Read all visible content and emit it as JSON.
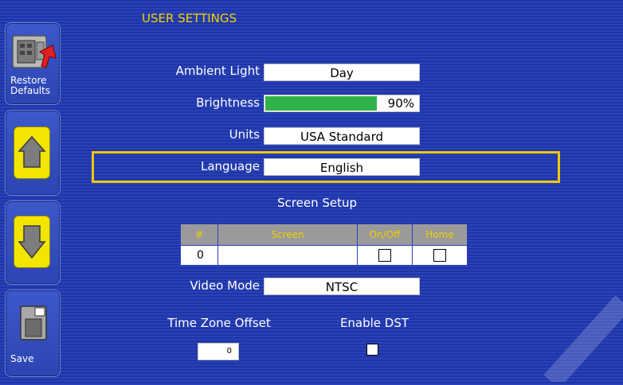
{
  "header": {
    "title": "USER SETTINGS"
  },
  "sidebar": {
    "restore_label_1": "Restore",
    "restore_label_2": "Defaults",
    "up_icon": "arrow-up-icon",
    "down_icon": "arrow-down-icon",
    "save_label": "Save"
  },
  "settings": {
    "ambient_light": {
      "label": "Ambient Light",
      "value": "Day"
    },
    "brightness": {
      "label": "Brightness",
      "value": "90%",
      "level": 0.9
    },
    "units": {
      "label": "Units",
      "value": "USA Standard"
    },
    "language": {
      "label": "Language",
      "value": "English"
    }
  },
  "screen_setup": {
    "title": "Screen Setup",
    "columns": [
      "#",
      "Screen",
      "On/Off",
      "Home"
    ],
    "rows": [
      {
        "num": "0",
        "screen": "",
        "on_off": false,
        "home": false
      }
    ]
  },
  "video_mode": {
    "label": "Video Mode",
    "value": "NTSC"
  },
  "time_zone": {
    "label": "Time Zone Offset",
    "value": "0"
  },
  "dst": {
    "label": "Enable DST",
    "checked": false
  },
  "colors": {
    "accent_yellow": "#f0d000",
    "brightness_green": "#2fb24a",
    "background_blue": "#2339aa"
  }
}
